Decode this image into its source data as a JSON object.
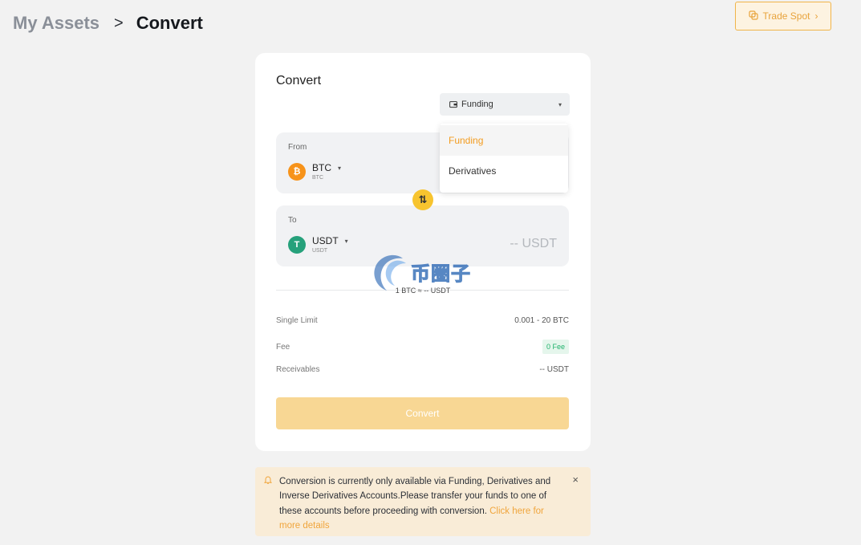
{
  "breadcrumb": {
    "parent": "My Assets",
    "separator": ">",
    "current": "Convert"
  },
  "header": {
    "trade_spot_label": "Trade Spot",
    "trade_spot_icon": "swap-icon",
    "chevron": "›"
  },
  "card": {
    "title": "Convert",
    "account_select": {
      "selected": "Funding",
      "icon": "wallet-icon"
    },
    "account_options": [
      {
        "label": "Funding",
        "active": true
      },
      {
        "label": "Derivatives",
        "active": false
      }
    ],
    "from": {
      "label": "From",
      "symbol": "BTC",
      "sub": "BTC",
      "icon_glyph": "₿",
      "icon_color": "#f7931a"
    },
    "to": {
      "label": "To",
      "symbol": "USDT",
      "sub": "USDT",
      "icon_glyph": "T",
      "icon_color": "#26a17b",
      "amount": "-- USDT"
    },
    "swap_glyph": "⇅",
    "rate": "1 BTC ≈ -- USDT",
    "details": [
      {
        "label": "Single Limit",
        "value": "0.001 - 20 BTC"
      },
      {
        "label": "Fee",
        "value": "0 Fee"
      },
      {
        "label": "Receivables",
        "value": "-- USDT"
      }
    ],
    "convert_button": "Convert"
  },
  "notice": {
    "text": "Conversion is currently only available via Funding, Derivatives and Inverse Derivatives Accounts.Please transfer your funds to one of these accounts before proceeding with conversion.",
    "link": "Click here for more details",
    "close": "×"
  },
  "watermark": {
    "text": "币圈子"
  },
  "colors": {
    "accent": "#f0a53c",
    "button": "#f8d794",
    "success": "#20b26c"
  }
}
